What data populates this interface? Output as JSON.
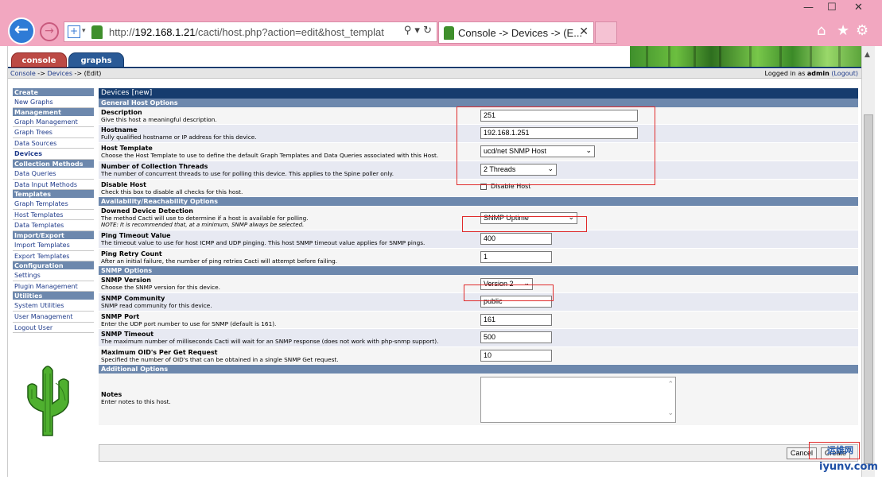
{
  "browser": {
    "url_prefix": "http://",
    "url_host": "192.168.1.21",
    "url_path": "/cacti/host.php?action=edit&host_templat",
    "tab_title": "Console -> Devices -> (E...",
    "minimize": "—",
    "maximize": "☐",
    "close": "✕"
  },
  "nav_tabs": {
    "console": "console",
    "graphs": "graphs"
  },
  "breadcrumb": {
    "console": "Console",
    "sep1": " -> ",
    "devices": "Devices",
    "sep2": " -> (Edit)"
  },
  "login": {
    "prefix": "Logged in as ",
    "user": "admin",
    "logout": "(Logout)"
  },
  "sidebar": [
    {
      "type": "head",
      "label": "Create"
    },
    {
      "type": "item",
      "label": "New Graphs"
    },
    {
      "type": "head",
      "label": "Management"
    },
    {
      "type": "item",
      "label": "Graph Management"
    },
    {
      "type": "item",
      "label": "Graph Trees"
    },
    {
      "type": "item",
      "label": "Data Sources"
    },
    {
      "type": "item",
      "label": "Devices",
      "selected": true
    },
    {
      "type": "head",
      "label": "Collection Methods"
    },
    {
      "type": "item",
      "label": "Data Queries"
    },
    {
      "type": "item",
      "label": "Data Input Methods"
    },
    {
      "type": "head",
      "label": "Templates"
    },
    {
      "type": "item",
      "label": "Graph Templates"
    },
    {
      "type": "item",
      "label": "Host Templates"
    },
    {
      "type": "item",
      "label": "Data Templates"
    },
    {
      "type": "head",
      "label": "Import/Export"
    },
    {
      "type": "item",
      "label": "Import Templates"
    },
    {
      "type": "item",
      "label": "Export Templates"
    },
    {
      "type": "head",
      "label": "Configuration"
    },
    {
      "type": "item",
      "label": "Settings"
    },
    {
      "type": "item",
      "label": "Plugin Management"
    },
    {
      "type": "head",
      "label": "Utilities"
    },
    {
      "type": "item",
      "label": "System Utilities"
    },
    {
      "type": "item",
      "label": "User Management"
    },
    {
      "type": "item",
      "label": "Logout User"
    }
  ],
  "form": {
    "title": "Devices",
    "title_suffix": "[new]",
    "sections": {
      "general": "General Host Options",
      "availability": "Availability/Reachability Options",
      "snmp": "SNMP Options",
      "additional": "Additional Options"
    },
    "description": {
      "label": "Description",
      "help": "Give this host a meaningful description.",
      "value": "251"
    },
    "hostname": {
      "label": "Hostname",
      "help": "Fully qualified hostname or IP address for this device.",
      "value": "192.168.1.251"
    },
    "host_template": {
      "label": "Host Template",
      "help": "Choose the Host Template to use to define the default Graph Templates and Data Queries associated with this Host.",
      "value": "ucd/net SNMP Host"
    },
    "threads": {
      "label": "Number of Collection Threads",
      "help": "The number of concurrent threads to use for polling this device. This applies to the Spine poller only.",
      "value": "2 Threads"
    },
    "disable_host": {
      "label": "Disable Host",
      "help": "Check this box to disable all checks for this host.",
      "checkbox_label": "Disable Host"
    },
    "downed_detection": {
      "label": "Downed Device Detection",
      "help": "The method Cacti will use to determine if a host is available for polling.",
      "note": "NOTE: It is recommended that, at a minimum, SNMP always be selected.",
      "value": "SNMP Uptime"
    },
    "ping_timeout": {
      "label": "Ping Timeout Value",
      "help": "The timeout value to use for host ICMP and UDP pinging. This host SNMP timeout value applies for SNMP pings.",
      "value": "400"
    },
    "ping_retry": {
      "label": "Ping Retry Count",
      "help": "After an initial failure, the number of ping retries Cacti will attempt before failing.",
      "value": "1"
    },
    "snmp_version": {
      "label": "SNMP Version",
      "help": "Choose the SNMP version for this device.",
      "value": "Version 2"
    },
    "snmp_community": {
      "label": "SNMP Community",
      "help": "SNMP read community for this device.",
      "value": "public"
    },
    "snmp_port": {
      "label": "SNMP Port",
      "help": "Enter the UDP port number to use for SNMP (default is 161).",
      "value": "161"
    },
    "snmp_timeout": {
      "label": "SNMP Timeout",
      "help": "The maximum number of milliseconds Cacti will wait for an SNMP response (does not work with php-snmp support).",
      "value": "500"
    },
    "max_oids": {
      "label": "Maximum OID's Per Get Request",
      "help": "Specified the number of OID's that can be obtained in a single SNMP Get request.",
      "value": "10"
    },
    "notes": {
      "label": "Notes",
      "help": "Enter notes to this host."
    }
  },
  "buttons": {
    "cancel": "Cancel",
    "create": "Create"
  },
  "watermark": {
    "cn": "运维网",
    "site": "iyunv.com"
  },
  "colors": {
    "chrome": "#f2a7c0",
    "header": "#163c6e",
    "section": "#6d88ad",
    "highlight": "#e02b2b"
  }
}
